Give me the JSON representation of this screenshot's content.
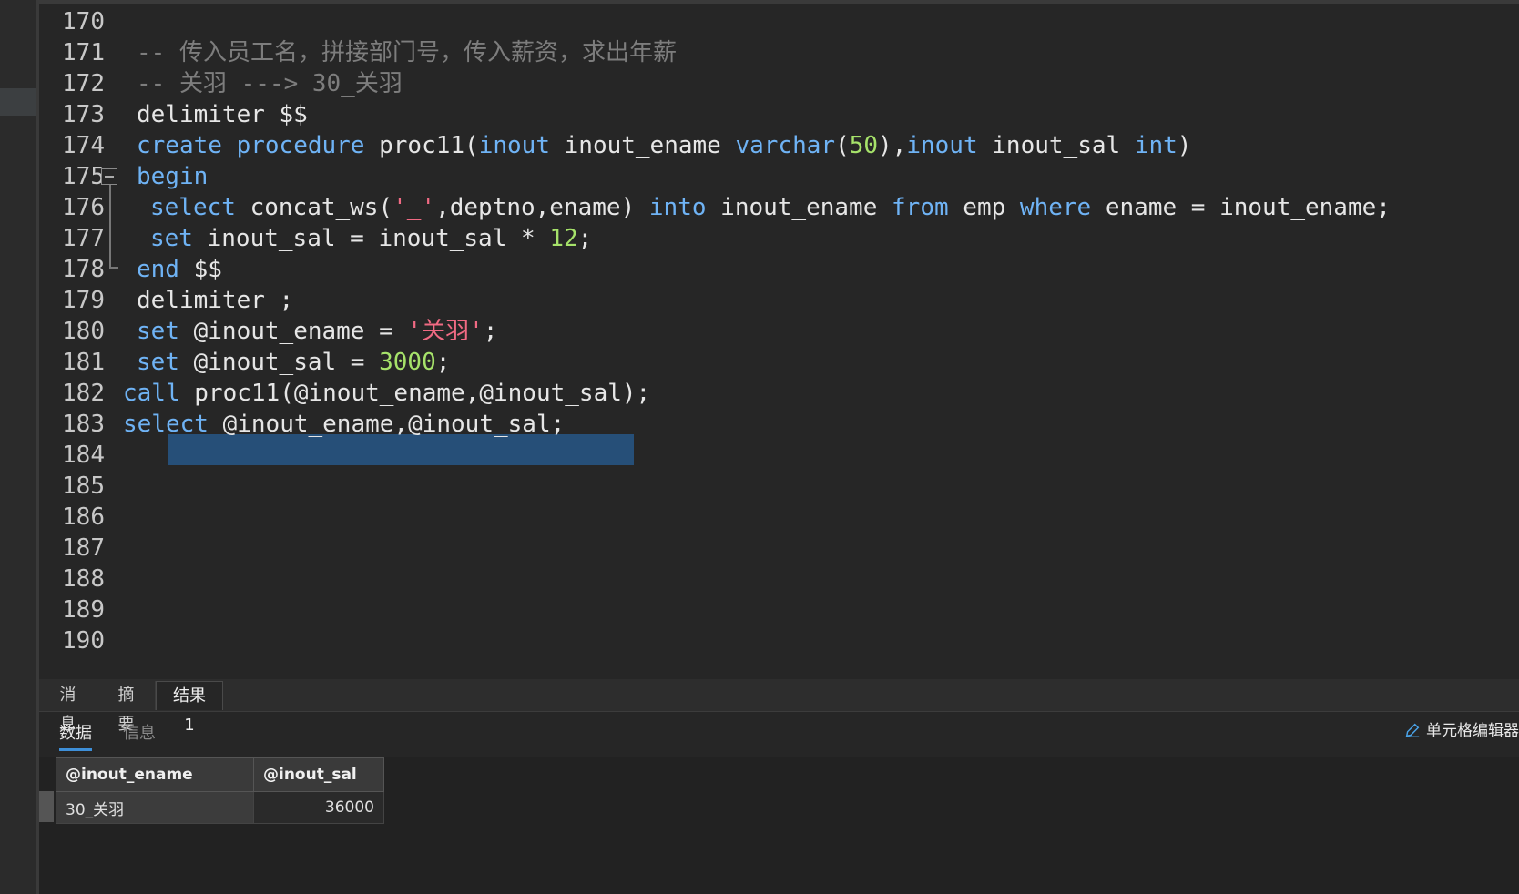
{
  "editor": {
    "line_numbers": [
      "170",
      "171",
      "172",
      "173",
      "174",
      "175",
      "176",
      "177",
      "178",
      "179",
      "180",
      "181",
      "182",
      "183",
      "184",
      "185",
      "186",
      "187",
      "188",
      "189",
      "190"
    ],
    "code": {
      "l171": "-- 传入员工名，拼接部门号，传入薪资，求出年薪",
      "l172": "-- 关羽 ---> 30_关羽",
      "l173": "delimiter $$",
      "l174_create": "create",
      "l174_procedure": "procedure",
      "l174_name": " proc11(",
      "l174_inout1": "inout",
      "l174_p1": " inout_ename ",
      "l174_varchar": "varchar",
      "l174_open": "(",
      "l174_50": "50",
      "l174_close": "),",
      "l174_inout2": "inout",
      "l174_p2": " inout_sal ",
      "l174_int": "int",
      "l174_end": ")",
      "l175": "begin",
      "l176_select": "select",
      "l176_a": " concat_ws(",
      "l176_str": "'_'",
      "l176_b": ",deptno,ename) ",
      "l176_into": "into",
      "l176_c": " inout_ename ",
      "l176_from": "from",
      "l176_d": " emp ",
      "l176_where": "where",
      "l176_e": " ename = inout_ename;",
      "l177_set": "set",
      "l177_a": " inout_sal = inout_sal * ",
      "l177_num": "12",
      "l177_b": ";",
      "l178_end": "end",
      "l178_a": " $$",
      "l179": "delimiter ;",
      "l180_set": "set",
      "l180_a": " @inout_ename = ",
      "l180_str": "'关羽'",
      "l180_b": ";",
      "l181_set": "set",
      "l181_a": " @inout_sal = ",
      "l181_num": "3000",
      "l181_b": ";",
      "l182_call": "call",
      "l182_a": " proc11(@inout_ename,@inout_sal);",
      "l183_select": "select",
      "l183_a": " @inout_ename,@inout_sal;"
    }
  },
  "result_panel": {
    "tabs": [
      "消息",
      "摘要",
      "结果 1"
    ],
    "subtabs": [
      "数据",
      "信息"
    ],
    "cell_editor_label": "单元格编辑器",
    "columns": [
      "@inout_ename",
      "@inout_sal"
    ],
    "rows": [
      [
        "30_关羽",
        "36000"
      ]
    ]
  },
  "colors": {
    "keyword": "#6fb3f5",
    "comment": "#7d7d7d",
    "string": "#f06a83",
    "number": "#a6e26a",
    "selection": "#264f78"
  }
}
